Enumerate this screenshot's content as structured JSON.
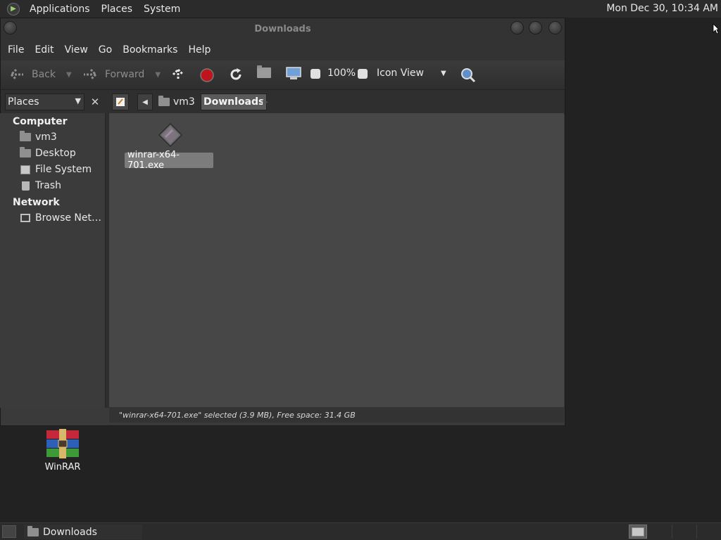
{
  "top_panel": {
    "menus": [
      "Applications",
      "Places",
      "System"
    ],
    "clock": "Mon Dec 30, 10:34 AM"
  },
  "window": {
    "title": "Downloads",
    "menubar": [
      "File",
      "Edit",
      "View",
      "Go",
      "Bookmarks",
      "Help"
    ],
    "toolbar": {
      "back_label": "Back",
      "forward_label": "Forward",
      "zoom": "100%",
      "view_mode": "Icon View"
    },
    "location": {
      "sidebar_mode": "Places",
      "crumbs": [
        "vm3",
        "Downloads"
      ]
    },
    "sidebar": {
      "sections": [
        {
          "heading": "Computer",
          "items": [
            "vm3",
            "Desktop",
            "File System",
            "Trash"
          ]
        },
        {
          "heading": "Network",
          "items": [
            "Browse Net…"
          ]
        }
      ]
    },
    "files": [
      {
        "name": "winrar-x64-701.exe",
        "selected": true
      }
    ],
    "status": "\"winrar-x64-701.exe\" selected (3.9 MB), Free space: 31.4 GB"
  },
  "desktop": {
    "icons": [
      {
        "label": "WinRAR"
      }
    ]
  },
  "bottom_panel": {
    "tasks": [
      "Downloads"
    ]
  },
  "colors": {
    "desktop_bg": "#222222",
    "panel_bg": "#2b2b2b",
    "content_bg": "#474747",
    "selection": "#7c7c7c",
    "stop_red": "#c0141c"
  }
}
